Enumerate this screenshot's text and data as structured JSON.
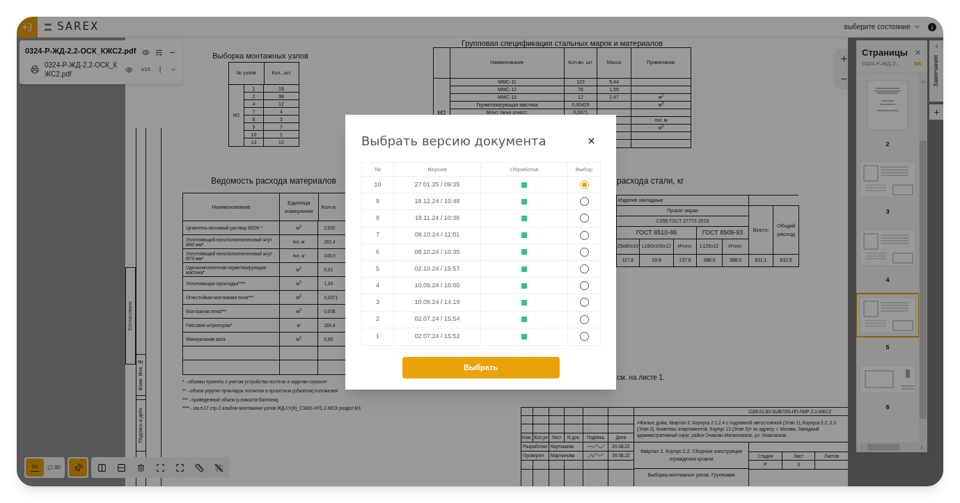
{
  "app": {
    "logo": "SAREX",
    "state_select": "выберите состояние"
  },
  "document_panel": {
    "title": "0324-Р-ЖД-2.2-ОСК_КЖС2.pdf",
    "file": {
      "name": "0324-Р-ЖД-2.2-ОСК_КЖС2.pdf",
      "version": "v10"
    }
  },
  "sheet": {
    "node_table": {
      "title": "Выборка монтажных узлов",
      "columns": [
        "№ узлов",
        "Кол., шт."
      ],
      "group": "М2",
      "rows": [
        [
          "1",
          "18"
        ],
        [
          "2",
          "38"
        ],
        [
          "4",
          "12"
        ],
        [
          "7",
          "4"
        ],
        [
          "8",
          "3"
        ],
        [
          "9",
          "7"
        ],
        [
          "10",
          "1"
        ],
        [
          "13",
          "12"
        ]
      ]
    },
    "spec_table": {
      "title": "Групповая спецификация стальных марок и материалов",
      "columns": [
        "Наименование",
        "Кол-во, шт.",
        "Масса",
        "Примечание"
      ],
      "group": "М2",
      "rows": [
        {
          "name": "ММС-11",
          "count": "122",
          "mass": "5,44"
        },
        {
          "name": "ММС-12",
          "count": "76",
          "mass": "1,55"
        },
        {
          "name": "ММС-13",
          "count": "12",
          "mass": "2,47",
          "note": "м$^{2}$"
        },
        {
          "name": "Герметизирующая мастика",
          "count": "0,00425",
          "note": "м$^{3}$"
        },
        {
          "name": "Монт. пена огнест.",
          "count": "0,0071"
        },
        {
          "note": "пог. м"
        },
        {
          "note": "м$^{2}$"
        }
      ]
    },
    "materials_table": {
      "title": "Ведомость расхода материалов",
      "columns": [
        "Наименование",
        "Единица измерения",
        "Кол-в"
      ],
      "rows": [
        {
          "name": "Цементно-песчаный раствор М200 *",
          "unit": "м$^{3}$",
          "qty": "2,002"
        },
        {
          "name": "Уплотняющий пенополиэтиленовый жгут Ø40 мм*",
          "unit": "пог. м",
          "qty": "292,4"
        },
        {
          "name": "Уплотняющий пенополиэтиленовый жгут Ø70 мм*",
          "unit": "пог. м",
          "qty": "145,9"
        },
        {
          "name": "Однокомпонентная герметизирующая мастика*",
          "unit": "м$^{3}$",
          "qty": "0,01"
        },
        {
          "name": "Уплотняющая прокладка****",
          "unit": "м$^{3}$",
          "qty": "1,34"
        },
        {
          "name": "Огнестойкая монтажная пена***",
          "unit": "м$^{3}$",
          "qty": "0,0071"
        },
        {
          "name": "Монтажная пена***",
          "unit": "м$^{3}$",
          "qty": "0,008"
        },
        {
          "name": "Гипсовая штукатурка*",
          "unit": "кг",
          "qty": "160,4"
        },
        {
          "name": "Минеральная вата",
          "unit": "м$^{3}$",
          "qty": "0,95"
        }
      ]
    },
    "notes": [
      "* - объемы приняты с учетом устройства постели и заделки горизонт",
      "** - объем упругих прокладок посчитан в проектном (обжатом) положении",
      "*** - приведенный объем (к емкости баллона)",
      "**** - см.п.17 стр.2 альбом монтажных узлов ЖД-Ст(К)_СЭМ2-НП1.2-МСК раздел М1"
    ],
    "steel_table": {
      "title": "расхода стали, кг",
      "group": "Изделия закладные",
      "product": "Прокат марки",
      "grade": "С355 ГОСТ 27772-2015",
      "standards": [
        "ГОСТ 8510-86",
        "ГОСТ 8509-93"
      ],
      "total": "Всего:",
      "overall": "Общий расход",
      "sizes": [
        "25x80x10",
        "L160x100x12",
        "Итого:",
        "L125x12",
        "Итого:"
      ],
      "values": [
        "117,6",
        "19,6",
        "137,6",
        "388,0",
        "388,0",
        "811,1",
        "812,5"
      ]
    },
    "note_ref": "см. на листе 1.",
    "stamps": [
      "Согласовано",
      "Взам. Инв. №",
      "Подпись и дата"
    ],
    "title_block": {
      "code": "1105.01.80-SUB7/20-НП-ПИР-2.2-КЖС2",
      "project": "«Жилые дома, Квартал 2. Корпуса 2.1,2.4 с подземной автостоянкой (Этап 1), Корпуса 2.2, 2.3 (Этап 2). Комплекс апартаментов. Корпус 13 (Этап 3)» по адресу: г. Москва, Западный административный округ, район Очаково-Матвеевское, ул. Очаковское",
      "columns": [
        "Изм.",
        "Кол.уч",
        "Лист",
        "N док.",
        "Подпись",
        "Дата"
      ],
      "signers": [
        {
          "role": "Разработал",
          "name": "Карташева",
          "date": "20.08.22"
        },
        {
          "role": "Проверил",
          "name": "Мартынова",
          "date": "09.08.22"
        }
      ],
      "object": "Квартал 2. Корпус 2.2. Сборные конструкции ограждения кровли",
      "stage_columns": [
        "Стадия",
        "Лист",
        "Листов"
      ],
      "stage": "Р",
      "sheet": "3",
      "sheet_title": "Выборка монтажных узлов. Групповая"
    }
  },
  "pages_panel": {
    "title": "Страницы",
    "file": "0324-Р-ЖД-2...",
    "counter": "5/6",
    "pages": [
      {
        "label": "2",
        "kind": "portrait",
        "selected": false
      },
      {
        "label": "3",
        "kind": "landscape",
        "selected": false
      },
      {
        "label": "4",
        "kind": "landscape",
        "selected": false
      },
      {
        "label": "5",
        "kind": "landscape",
        "selected": true
      },
      {
        "label": "6",
        "kind": "plan",
        "selected": false
      }
    ]
  },
  "side_tab": {
    "label": "Замечания"
  },
  "toolbar": [
    {
      "tools": [
        {
          "kind": "flat",
          "label": "2D",
          "active": true
        },
        {
          "kind": "orbit",
          "label": "3D",
          "active": false
        }
      ]
    },
    {
      "tools": [
        {
          "kind": "pin",
          "active": true
        }
      ]
    },
    {
      "tools": [
        {
          "kind": "columns",
          "active": false
        },
        {
          "kind": "rows",
          "active": false
        },
        {
          "kind": "trash",
          "active": false
        },
        {
          "kind": "fit",
          "active": false
        },
        {
          "kind": "expand",
          "active": false
        },
        {
          "kind": "ruler",
          "active": false
        },
        {
          "kind": "grid",
          "active": false
        }
      ]
    }
  ],
  "dialog": {
    "title": "Выбрать версию документа",
    "columns": [
      "№",
      "Версия",
      "Обработка",
      "Выбор"
    ],
    "rows": [
      {
        "number": "10",
        "version": "27.01.25 / 09:35",
        "processed": true,
        "selected": true
      },
      {
        "number": "9",
        "version": "18.12.24 / 10:48",
        "processed": true,
        "selected": false
      },
      {
        "number": "8",
        "version": "18.11.24 / 10:38",
        "processed": true,
        "selected": false
      },
      {
        "number": "7",
        "version": "08.10.24 / 11:01",
        "processed": true,
        "selected": false
      },
      {
        "number": "6",
        "version": "08.10.24 / 10:35",
        "processed": true,
        "selected": false
      },
      {
        "number": "5",
        "version": "02.10.24 / 15:57",
        "processed": true,
        "selected": false
      },
      {
        "number": "4",
        "version": "10.09.24 / 16:00",
        "processed": true,
        "selected": false
      },
      {
        "number": "3",
        "version": "10.09.24 / 14:19",
        "processed": true,
        "selected": false
      },
      {
        "number": "2",
        "version": "02.07.24 / 15:54",
        "processed": true,
        "selected": false
      },
      {
        "number": "1",
        "version": "02.07.24 / 15:52",
        "processed": true,
        "selected": false
      }
    ],
    "button": "Выбрать"
  }
}
